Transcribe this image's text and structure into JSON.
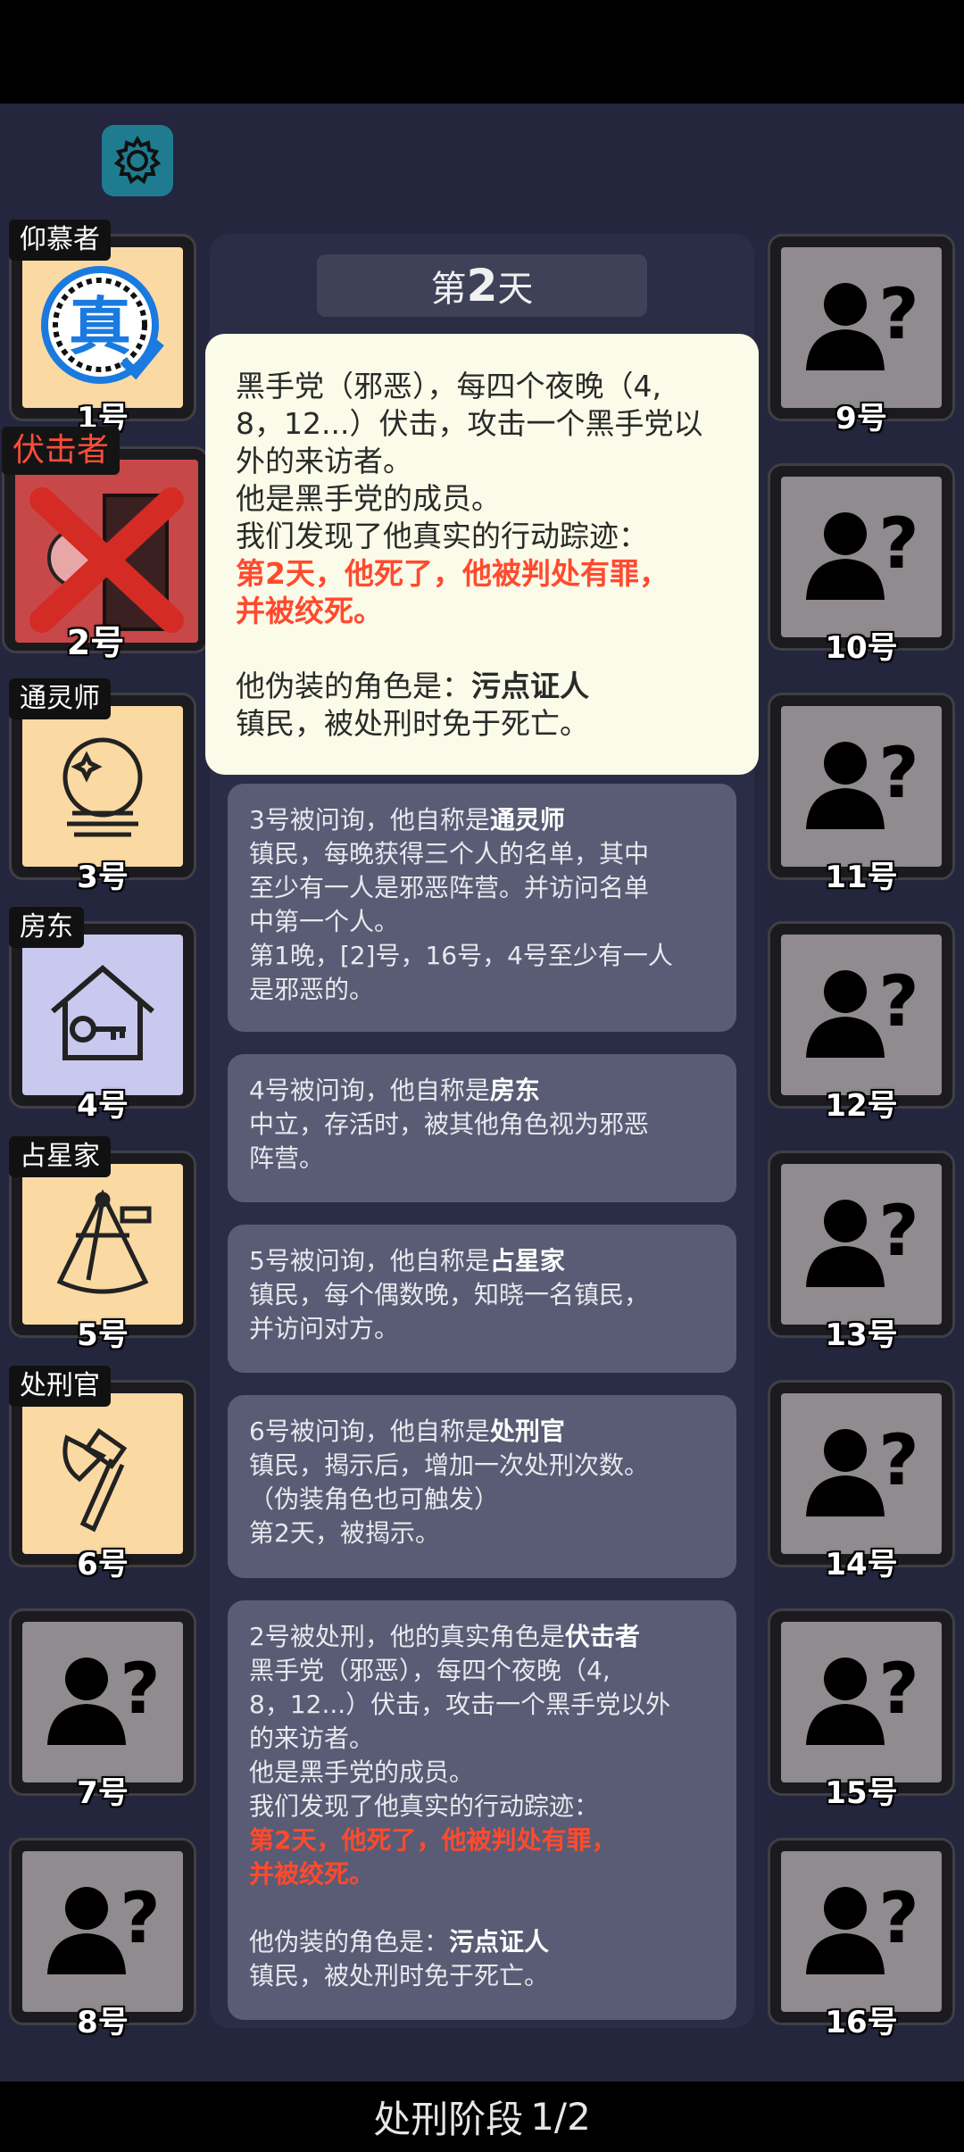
{
  "day": {
    "prefix": "第",
    "number": "2",
    "suffix": "天"
  },
  "players_left": [
    {
      "num": "1号",
      "role": "仰慕者",
      "icon": "admirer-emblem-icon"
    },
    {
      "num": "2号",
      "role": "伏击者",
      "icon": "ambusher-dead-icon",
      "status": "dead"
    },
    {
      "num": "3号",
      "role": "通灵师",
      "icon": "crystal-ball-icon"
    },
    {
      "num": "4号",
      "role": "房东",
      "icon": "house-key-icon"
    },
    {
      "num": "5号",
      "role": "占星家",
      "icon": "sextant-icon"
    },
    {
      "num": "6号",
      "role": "处刑官",
      "icon": "axe-icon"
    },
    {
      "num": "7号",
      "role": "",
      "icon": "unknown-person-icon"
    },
    {
      "num": "8号",
      "role": "",
      "icon": "unknown-person-icon"
    }
  ],
  "players_right": [
    {
      "num": "9号"
    },
    {
      "num": "10号"
    },
    {
      "num": "11号"
    },
    {
      "num": "12号"
    },
    {
      "num": "13号"
    },
    {
      "num": "14号"
    },
    {
      "num": "15号"
    },
    {
      "num": "16号"
    }
  ],
  "popup": {
    "line1": "黑手党（邪恶），每四个夜晚（4,",
    "line2": "8，12...）伏击，攻击一个黑手党以",
    "line3": "外的来访者。",
    "line4": "他是黑手党的成员。",
    "line5": "我们发现了他真实的行动踪迹：",
    "hl1": "第2天，他死了，他被判处有罪，",
    "hl2": "并被绞死。",
    "disguise_prefix": "他伪装的角色是：",
    "disguise_role": "污点证人",
    "disguise_desc": "镇民，被处刑时免于死亡。"
  },
  "logs": [
    {
      "prefix": "3号被问询，他自称是",
      "role": "通灵师",
      "lines": [
        "镇民，每晚获得三个人的名单，其中",
        "至少有一人是邪恶阵营。并访问名单",
        "中第一个人。",
        "第1晚，[2]号，16号，4号至少有一人",
        "是邪恶的。"
      ]
    },
    {
      "prefix": "4号被问询，他自称是",
      "role": "房东",
      "lines": [
        "中立，存活时，被其他角色视为邪恶",
        "阵营。"
      ]
    },
    {
      "prefix": "5号被问询，他自称是",
      "role": "占星家",
      "lines": [
        "镇民，每个偶数晚，知晓一名镇民，",
        "并访问对方。"
      ]
    },
    {
      "prefix": "6号被问询，他自称是",
      "role": "处刑官",
      "lines": [
        "镇民，揭示后，增加一次处刑次数。",
        "（伪装角色也可触发）",
        "第2天，被揭示。"
      ]
    },
    {
      "prefix": "2号被处刑，他的真实角色是",
      "role": "伏击者",
      "lines": [
        "黑手党（邪恶），每四个夜晚（4,",
        "8，12...）伏击，攻击一个黑手党以外",
        "的来访者。",
        "他是黑手党的成员。",
        "我们发现了他真实的行动踪迹："
      ],
      "hl1": "第2天，他死了，他被判处有罪，",
      "hl2": "并被绞死。",
      "disguise_prefix": "他伪装的角色是：",
      "disguise_role": "污点证人",
      "disguise_desc": "镇民，被处刑时免于死亡。"
    }
  ],
  "phase": {
    "label": "处刑阶段",
    "progress": "1/2"
  },
  "colors": {
    "background": "#24263e",
    "card_peach": "#fbd9a3",
    "card_lavender": "#c9c8ee",
    "card_unknown": "#8f8b8f",
    "highlight_red": "#ff4a2e",
    "gear": "#1f7c90"
  }
}
